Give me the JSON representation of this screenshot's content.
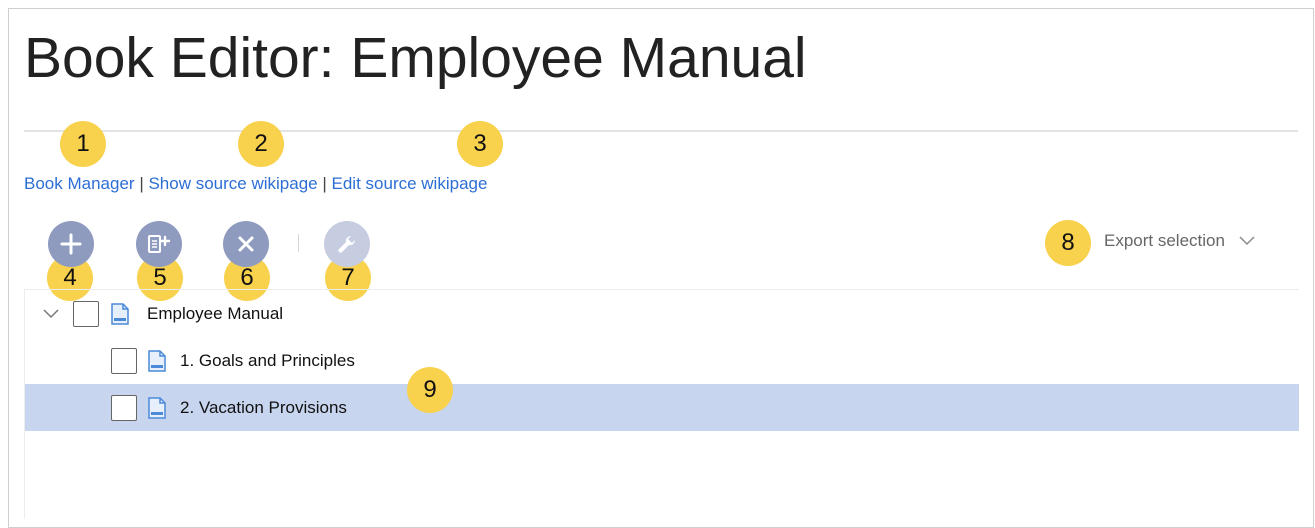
{
  "page": {
    "title": "Book Editor: Employee Manual"
  },
  "links": {
    "book_manager": "Book Manager",
    "show_source": "Show source wikipage",
    "edit_source": "Edit source wikipage",
    "separator": "|"
  },
  "toolbar": {
    "add_icon": "plus-icon",
    "add_subpage_icon": "add-page-icon",
    "remove_icon": "close-icon",
    "tools_icon": "wrench-icon",
    "export_label": "Export selection"
  },
  "badges": [
    "1",
    "2",
    "3",
    "4",
    "5",
    "6",
    "7",
    "8",
    "9"
  ],
  "tree": {
    "items": [
      {
        "label": "Employee Manual",
        "level": 0,
        "expanded": true,
        "selected": false
      },
      {
        "label": "1. Goals and Principles",
        "level": 1,
        "selected": false
      },
      {
        "label": "2. Vacation Provisions",
        "level": 1,
        "selected": true
      }
    ]
  },
  "colors": {
    "link": "#2c6ed5",
    "badge": "#f8d14d",
    "tool_button": "#8e9bbf",
    "tool_button_disabled": "#c7cde0",
    "selected_row": "#c8d5ef"
  }
}
